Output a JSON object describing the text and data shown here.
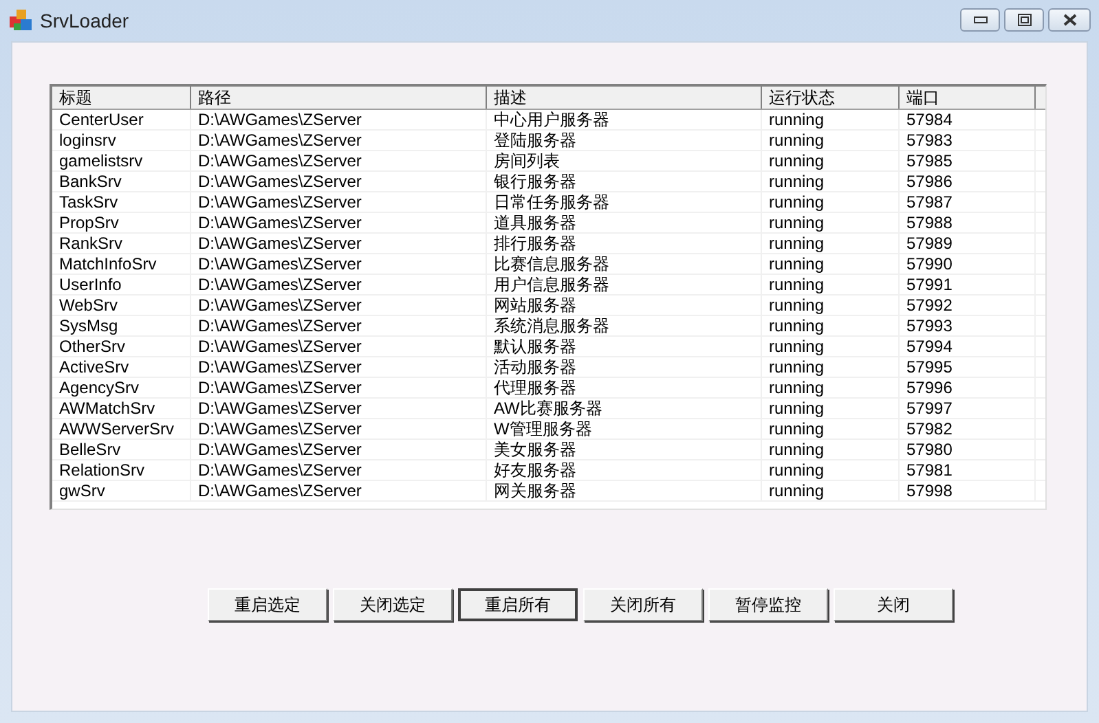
{
  "window": {
    "title": "SrvLoader"
  },
  "table": {
    "columns": [
      "标题",
      "路径",
      "描述",
      "运行状态",
      "端口"
    ],
    "rows": [
      [
        "CenterUser",
        "D:\\AWGames\\ZServer",
        "中心用户服务器",
        "running",
        "57984"
      ],
      [
        "loginsrv",
        "D:\\AWGames\\ZServer",
        "登陆服务器",
        "running",
        "57983"
      ],
      [
        "gamelistsrv",
        "D:\\AWGames\\ZServer",
        "房间列表",
        "running",
        "57985"
      ],
      [
        "BankSrv",
        "D:\\AWGames\\ZServer",
        "银行服务器",
        "running",
        "57986"
      ],
      [
        "TaskSrv",
        "D:\\AWGames\\ZServer",
        "日常任务服务器",
        "running",
        "57987"
      ],
      [
        "PropSrv",
        "D:\\AWGames\\ZServer",
        "道具服务器",
        "running",
        "57988"
      ],
      [
        "RankSrv",
        "D:\\AWGames\\ZServer",
        "排行服务器",
        "running",
        "57989"
      ],
      [
        "MatchInfoSrv",
        "D:\\AWGames\\ZServer",
        "比赛信息服务器",
        "running",
        "57990"
      ],
      [
        "UserInfo",
        "D:\\AWGames\\ZServer",
        "用户信息服务器",
        "running",
        "57991"
      ],
      [
        "WebSrv",
        "D:\\AWGames\\ZServer",
        "网站服务器",
        "running",
        "57992"
      ],
      [
        "SysMsg",
        "D:\\AWGames\\ZServer",
        "系统消息服务器",
        "running",
        "57993"
      ],
      [
        "OtherSrv",
        "D:\\AWGames\\ZServer",
        "默认服务器",
        "running",
        "57994"
      ],
      [
        "ActiveSrv",
        "D:\\AWGames\\ZServer",
        "活动服务器",
        "running",
        "57995"
      ],
      [
        "AgencySrv",
        "D:\\AWGames\\ZServer",
        "代理服务器",
        "running",
        "57996"
      ],
      [
        "AWMatchSrv",
        "D:\\AWGames\\ZServer",
        "AW比赛服务器",
        "running",
        "57997"
      ],
      [
        "AWWServerSrv",
        "D:\\AWGames\\ZServer",
        "W管理服务器",
        "running",
        "57982"
      ],
      [
        "BelleSrv",
        "D:\\AWGames\\ZServer",
        "美女服务器",
        "running",
        "57980"
      ],
      [
        "RelationSrv",
        "D:\\AWGames\\ZServer",
        "好友服务器",
        "running",
        "57981"
      ],
      [
        "gwSrv",
        "D:\\AWGames\\ZServer",
        "网关服务器",
        "running",
        "57998"
      ]
    ]
  },
  "buttons": [
    {
      "label": "重启选定",
      "focused": false
    },
    {
      "label": "关闭选定",
      "focused": false
    },
    {
      "label": "重启所有",
      "focused": true
    },
    {
      "label": "关闭所有",
      "focused": false
    },
    {
      "label": "暂停监控",
      "focused": false
    },
    {
      "label": "关闭",
      "focused": false
    }
  ]
}
